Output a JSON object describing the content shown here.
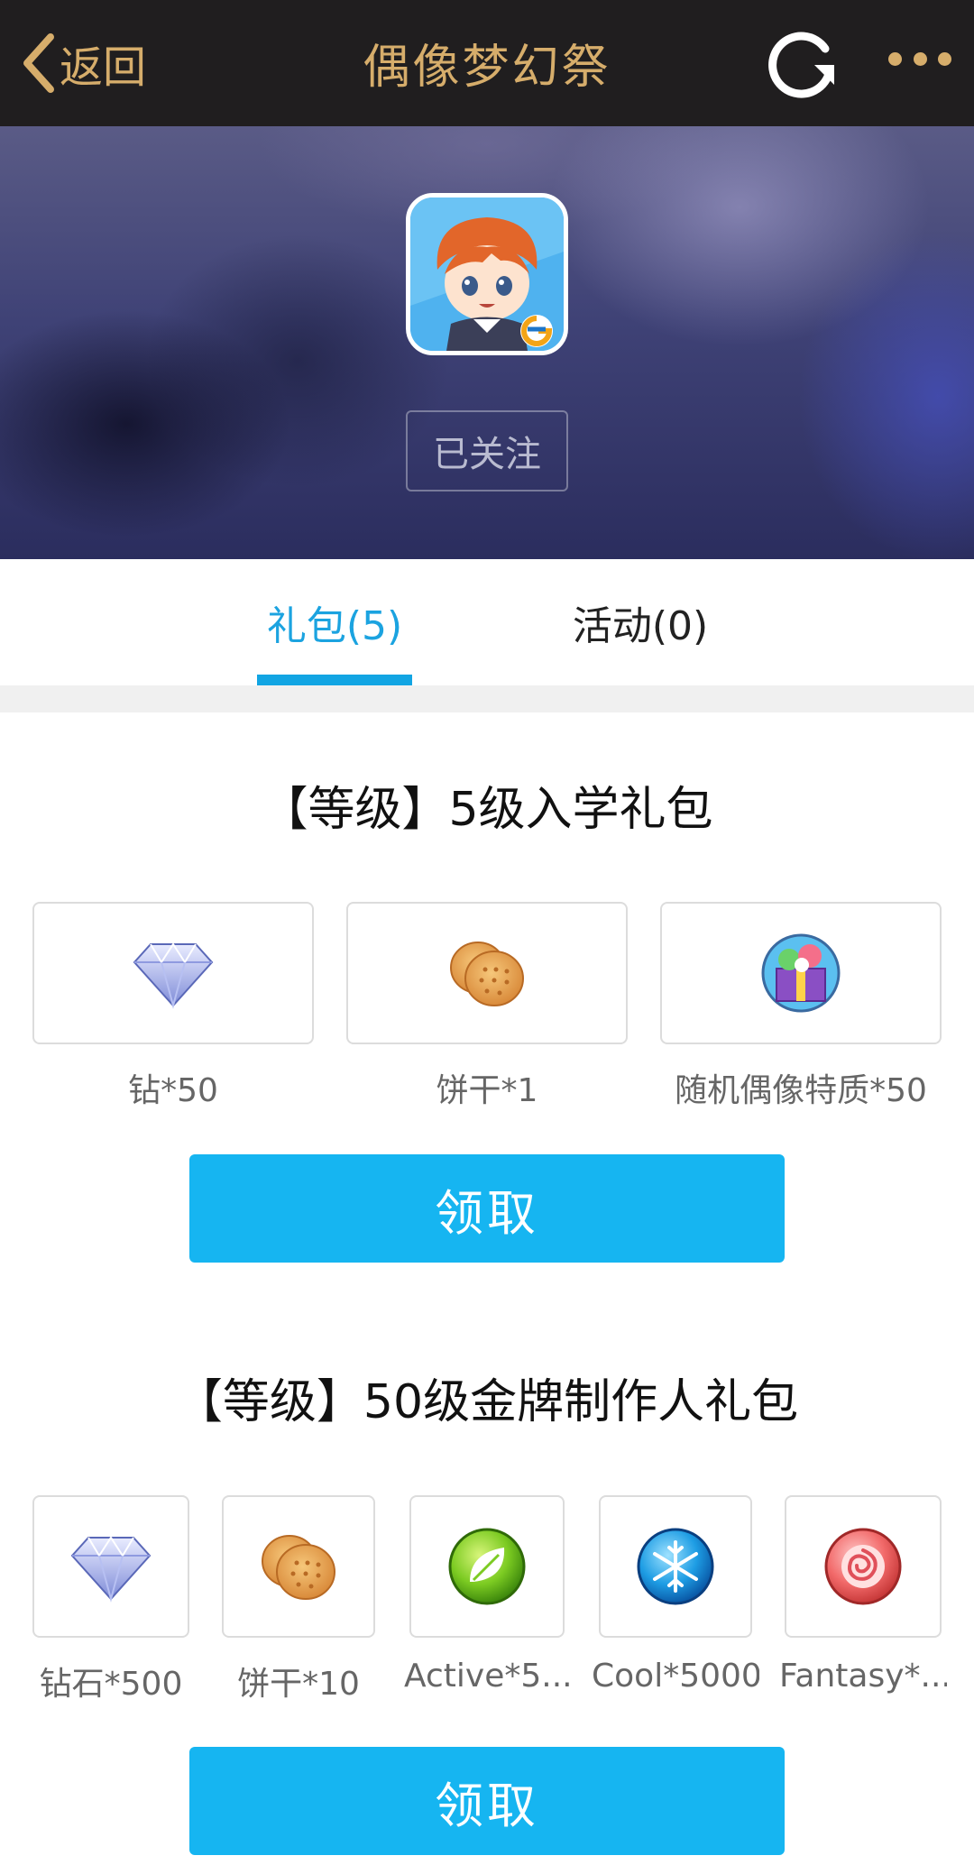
{
  "topbar": {
    "back_label": "返回",
    "title": "偶像梦幻祭",
    "accent_color": "#d6ad6b"
  },
  "header": {
    "app_icon": "game-app-icon",
    "follow_label": "已关注"
  },
  "tabs": [
    {
      "label": "礼包(5)",
      "active": true
    },
    {
      "label": "活动(0)",
      "active": false
    }
  ],
  "packs": [
    {
      "title": "【等级】5级入学礼包",
      "items": [
        {
          "icon": "diamond-icon",
          "label": "钻*50"
        },
        {
          "icon": "biscuit-icon",
          "label": "饼干*1"
        },
        {
          "icon": "gift-box-icon",
          "label": "随机偶像特质*50"
        }
      ],
      "button_label": "领取"
    },
    {
      "title": "【等级】50级金牌制作人礼包",
      "items": [
        {
          "icon": "diamond-icon",
          "label": "钻石*500"
        },
        {
          "icon": "biscuit-icon",
          "label": "饼干*10"
        },
        {
          "icon": "leaf-orb-icon",
          "label": "Active*5..."
        },
        {
          "icon": "snowflake-orb-icon",
          "label": "Cool*5000"
        },
        {
          "icon": "rose-orb-icon",
          "label": "Fantasy*..."
        }
      ],
      "button_label": "领取"
    }
  ],
  "colors": {
    "accent_blue": "#16b5f1",
    "topbar_bg": "#201e1f"
  }
}
